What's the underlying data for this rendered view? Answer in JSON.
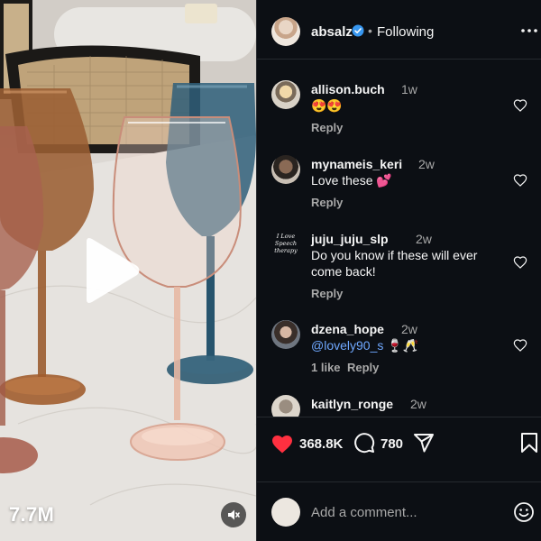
{
  "video": {
    "view_count": "7.7M",
    "play_icon": "play-icon",
    "mute_icon": "speaker-muted-icon"
  },
  "header": {
    "username": "absalz",
    "separator": "•",
    "follow_status": "Following",
    "verified_color": "#3897f0"
  },
  "comments": [
    {
      "username": "allison.buch",
      "time": "1w",
      "text": "😍😍",
      "reply_label": "Reply"
    },
    {
      "username": "mynameis_keri",
      "time": "2w",
      "text": "Love these 💕",
      "reply_label": "Reply"
    },
    {
      "username": "juju_juju_slp",
      "time": "2w",
      "text": "Do you know if these will ever come back!",
      "reply_label": "Reply",
      "avatar_text": "I Love Speech Therapy"
    },
    {
      "username": "dzena_hope",
      "time": "2w",
      "text": "@lovely90_s 🍷🥂",
      "likes_label": "1 like",
      "reply_label": "Reply"
    },
    {
      "username": "kaitlyn_ronge",
      "time": "2w",
      "text": "",
      "reply_label": ""
    }
  ],
  "actions": {
    "like_count": "368.8K",
    "comment_count": "780",
    "like_color": "#ff3040"
  },
  "comment_box": {
    "placeholder": "Add a comment..."
  }
}
